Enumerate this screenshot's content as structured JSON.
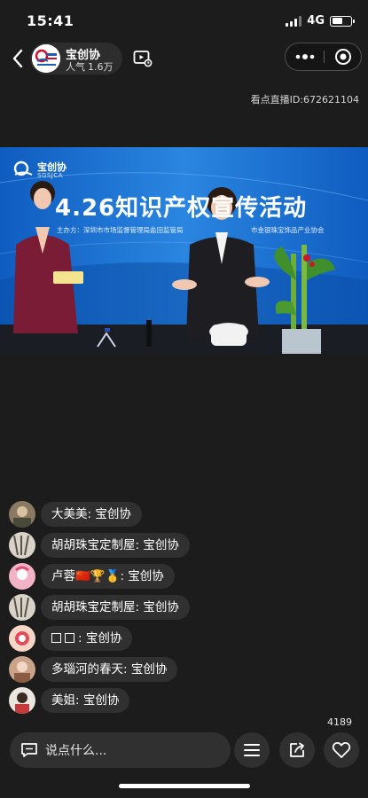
{
  "status": {
    "time": "15:41",
    "network": "4G",
    "battery_level": 0.55
  },
  "header": {
    "host_name": "宝创协",
    "popularity_label": "人气",
    "popularity_value": "1.6万",
    "avatar_icon": "sgsjca-logo-icon",
    "back_icon": "back-arrow-icon",
    "replay_icon": "playback-list-icon",
    "more_icon": "more-dots-icon",
    "close_icon": "target-close-icon"
  },
  "live_id": "看点直播ID:672621104",
  "video": {
    "brand_text": "宝创协",
    "brand_sub": "SGSJCA",
    "title": "4.26知识产权宣传活动",
    "organizer": "主办方：深圳市市场监督管理局盐田监管局",
    "organizer_2": "市金银珠宝饰品产业协会"
  },
  "chat": [
    {
      "user": "大美美",
      "message": "宝创协",
      "badges": []
    },
    {
      "user": "胡胡珠宝定制屋",
      "message": "宝创协",
      "badges": []
    },
    {
      "user": "卢蓉",
      "message": "宝创协",
      "badges": [
        "🇨🇳",
        "🏆",
        "🥇"
      ]
    },
    {
      "user": "胡胡珠宝定制屋",
      "message": "宝创协",
      "badges": []
    },
    {
      "user": "",
      "message": "宝创协",
      "badges": [
        "square",
        "square"
      ]
    },
    {
      "user": "多瑙河的春天",
      "message": "宝创协",
      "badges": []
    },
    {
      "user": "美姐",
      "message": "宝创协",
      "badges": []
    }
  ],
  "chat_separator": ":",
  "like_count": "4189",
  "bottom": {
    "comment_placeholder": "说点什么...",
    "menu_icon": "menu-icon",
    "share_icon": "share-icon",
    "like_icon": "heart-icon"
  },
  "colors": {
    "background": "#1c1c1c",
    "video_blue": "#1a7ad9",
    "brand_red": "#c8102e"
  }
}
